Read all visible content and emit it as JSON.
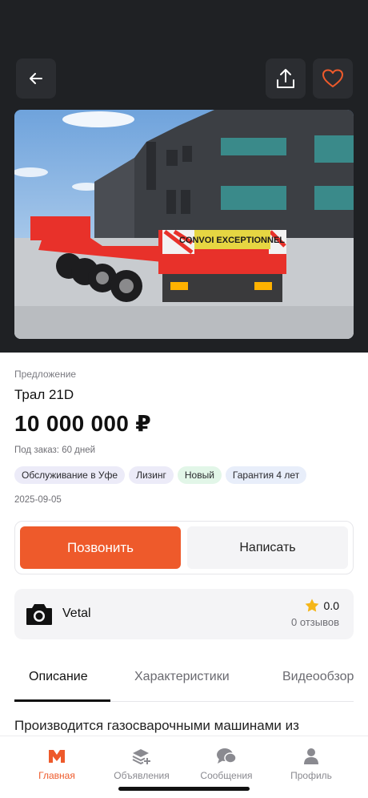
{
  "header": {
    "back_icon": "arrow-left-icon",
    "share_icon": "share-icon",
    "favorite_icon": "heart-icon",
    "accent_color": "#ee5a2b"
  },
  "listing": {
    "kind": "Предложение",
    "title": "Трал 21D",
    "price": "10 000 000 ₽",
    "order_terms": "Под заказ: 60 дней",
    "tags": [
      {
        "label": "Обслуживание в Уфе"
      },
      {
        "label": "Лизинг"
      },
      {
        "label": "Новый"
      },
      {
        "label": "Гарантия 4 лет"
      }
    ],
    "date": "2025-09-05",
    "photo_sign_text": "CONVOI EXCEPTIONNEL"
  },
  "actions": {
    "call_label": "Позвонить",
    "write_label": "Написать"
  },
  "seller": {
    "name": "Vetal",
    "avatar_icon": "camera-icon",
    "rating": "0.0",
    "reviews": "0 отзывов"
  },
  "tabs": [
    {
      "label": "Описание"
    },
    {
      "label": "Характеристики"
    },
    {
      "label": "Видеообзор"
    }
  ],
  "description": "Производится газосварочными машинами из",
  "bottom_nav": [
    {
      "label": "Главная",
      "icon": "home-logo-icon"
    },
    {
      "label": "Объявления",
      "icon": "layers-plus-icon"
    },
    {
      "label": "Сообщения",
      "icon": "chat-bubbles-icon"
    },
    {
      "label": "Профиль",
      "icon": "user-icon"
    }
  ]
}
